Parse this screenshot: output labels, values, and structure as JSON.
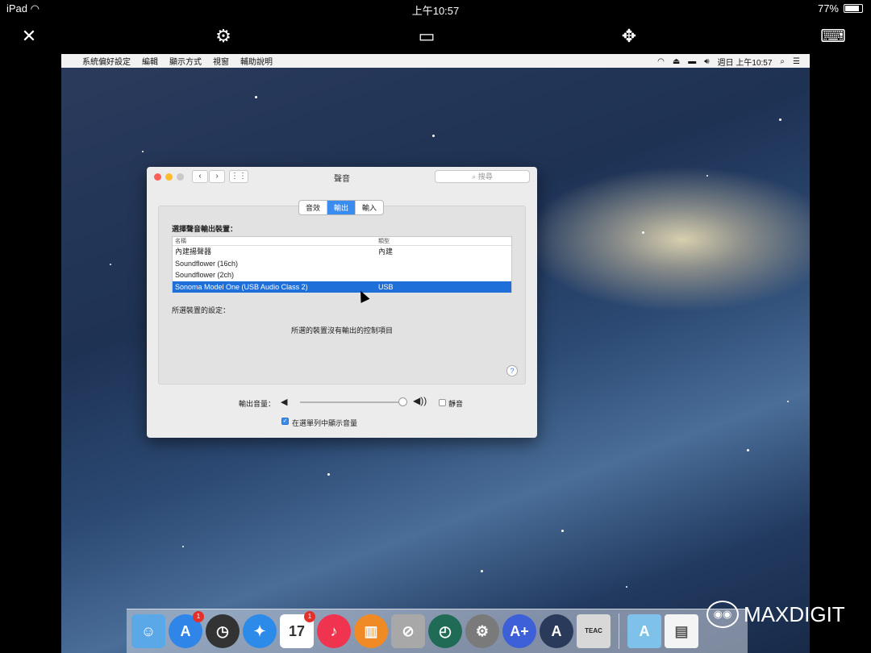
{
  "ios_status": {
    "device": "iPad",
    "time": "上午10:57",
    "battery": "77%",
    "battery_level": 0.77
  },
  "app_toolbar": {
    "icons": [
      "close-icon",
      "gear-icon",
      "display-layout-icon",
      "move-icon",
      "keyboard-icon"
    ]
  },
  "menubar": {
    "items": [
      "系統偏好設定",
      "編輯",
      "顯示方式",
      "視窗",
      "輔助說明"
    ],
    "clock": "週日 上午10:57"
  },
  "window": {
    "title": "聲音",
    "search_placeholder": "搜尋",
    "tabs": [
      {
        "label": "音效",
        "active": false
      },
      {
        "label": "輸出",
        "active": true
      },
      {
        "label": "輸入",
        "active": false
      }
    ],
    "select_label": "選擇聲音輸出裝置：",
    "columns": [
      "名稱",
      "類型"
    ],
    "devices": [
      {
        "name": "內建揚聲器",
        "type": "內建",
        "selected": false
      },
      {
        "name": "Soundflower (16ch)",
        "type": "",
        "selected": false
      },
      {
        "name": "Soundflower (2ch)",
        "type": "",
        "selected": false
      },
      {
        "name": "Sonoma Model One (USB Audio Class 2)",
        "type": "USB",
        "selected": true
      }
    ],
    "settings_label": "所選裝置的設定：",
    "no_controls": "所選的裝置沒有輸出的控制項目",
    "help": "?",
    "volume_label": "輸出音量：",
    "volume_level": 0.95,
    "mute_label": "靜音",
    "mute_checked": false,
    "show_volume_label": "在選單列中顯示音量",
    "show_volume_checked": true
  },
  "dock": {
    "items": [
      {
        "name": "finder",
        "badge": ""
      },
      {
        "name": "app-store",
        "badge": "1"
      },
      {
        "name": "dashboard",
        "badge": ""
      },
      {
        "name": "safari",
        "badge": ""
      },
      {
        "name": "calendar",
        "badge": "1",
        "text": "17"
      },
      {
        "name": "itunes",
        "badge": ""
      },
      {
        "name": "ibooks",
        "badge": ""
      },
      {
        "name": "photo-booth",
        "badge": ""
      },
      {
        "name": "time-machine",
        "badge": ""
      },
      {
        "name": "system-preferences",
        "badge": ""
      },
      {
        "name": "audirvana-plus",
        "badge": ""
      },
      {
        "name": "audirvana",
        "badge": ""
      },
      {
        "name": "teac-hr-audio-player",
        "badge": "",
        "text": "TEAC"
      }
    ]
  },
  "watermark": {
    "text": "MAXDIGIT"
  }
}
